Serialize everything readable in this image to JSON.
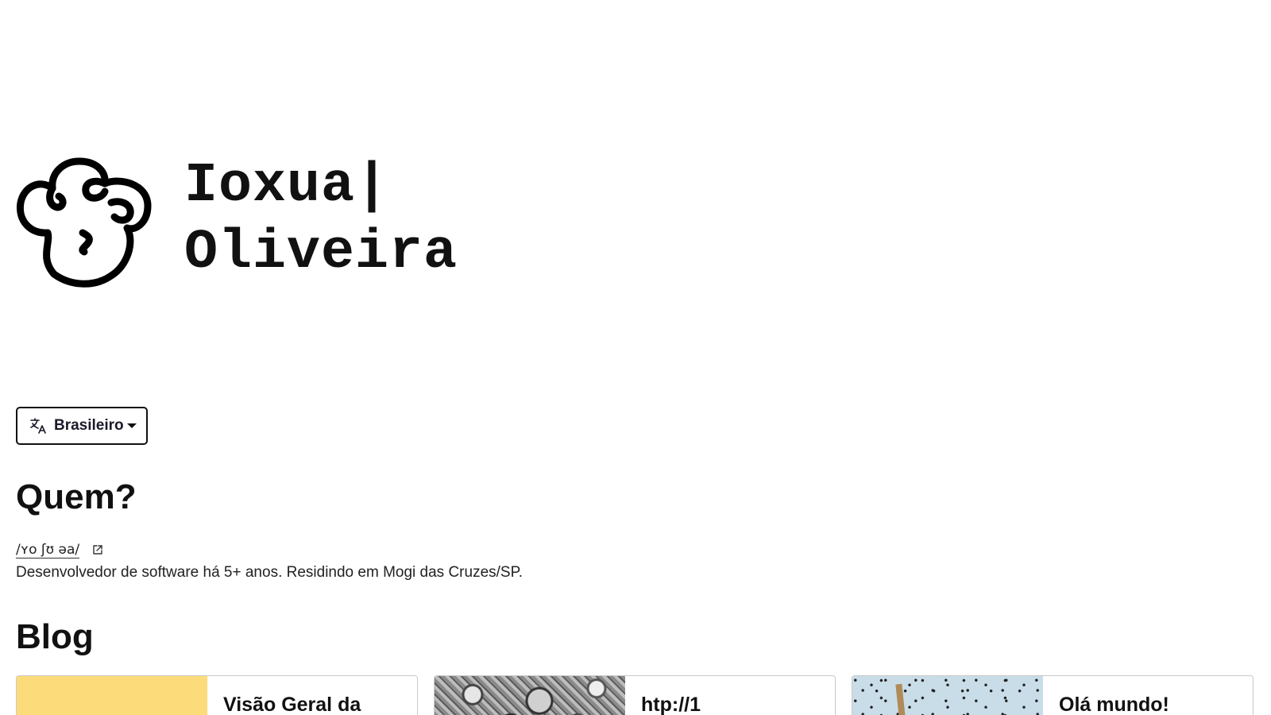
{
  "brand": {
    "name_line1": "Ioxua|",
    "name_line2": "Oliveira",
    "logo_icon": "doodle-head-logo"
  },
  "language_selector": {
    "icon": "translate-icon",
    "selected": "Brasileiro"
  },
  "about": {
    "title": "Quem?",
    "pronunciation": "/ʏo ʃʊ əa/",
    "pronunciation_icon": "external-link-icon",
    "bio": "Desenvolvedor de software há 5+ anos. Residindo em Mogi das Cruzes/SP."
  },
  "blog": {
    "title": "Blog",
    "posts": [
      {
        "title": "Visão Geral da",
        "thumb": "yellow"
      },
      {
        "title": "htp://1",
        "thumb": "gears"
      },
      {
        "title": "Olá mundo!",
        "thumb": "sky"
      }
    ]
  },
  "colors": {
    "text": "#111111",
    "card_border": "#c9c9c9",
    "thumb_yellow": "#fcdc7a",
    "thumb_sky": "#c9dde8"
  }
}
